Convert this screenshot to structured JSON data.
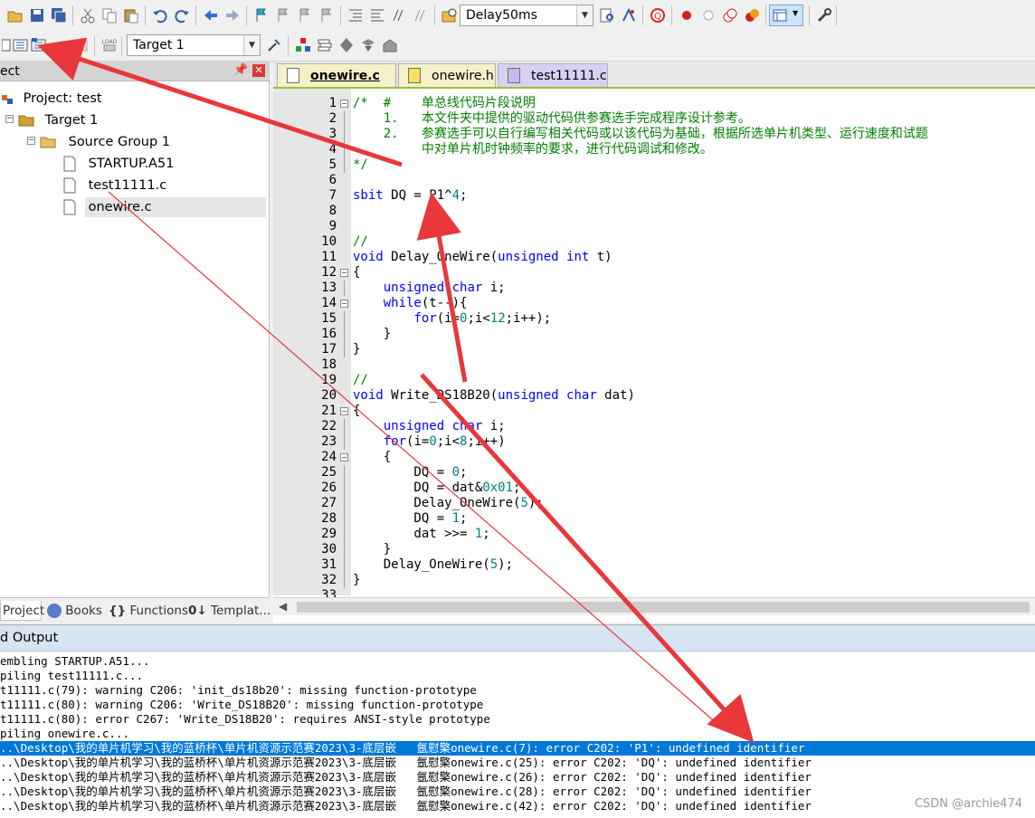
{
  "toolbar1": {
    "function_combo": "Delay50ms"
  },
  "toolbar2": {
    "target_combo": "Target 1"
  },
  "project_panel": {
    "title": "ect",
    "tree": [
      {
        "label": "Project: test",
        "icon": "project-icon"
      },
      {
        "label": "Target 1",
        "icon": "folder-icon"
      },
      {
        "label": "Source Group 1",
        "icon": "folder-icon"
      },
      {
        "label": "STARTUP.A51",
        "icon": "file-icon"
      },
      {
        "label": "test11111.c",
        "icon": "file-icon"
      },
      {
        "label": "onewire.c",
        "icon": "file-icon"
      }
    ],
    "tabs": [
      {
        "label": "Project"
      },
      {
        "label": "Books"
      },
      {
        "label": "Functions"
      },
      {
        "label": "Templat..."
      }
    ]
  },
  "editor": {
    "tabs": [
      {
        "label": "onewire.c",
        "color": "#f5f0c8",
        "active": true
      },
      {
        "label": "onewire.h",
        "color": "#f5f0c8",
        "active": false
      },
      {
        "label": "test11111.c",
        "color": "#d8d0f0",
        "active": false
      }
    ],
    "line_numbers": [
      "1",
      "2",
      "3",
      "4",
      "5",
      "6",
      "7",
      "8",
      "9",
      "10",
      "11",
      "12",
      "13",
      "14",
      "15",
      "16",
      "17",
      "18",
      "19",
      "20",
      "21",
      "22",
      "23",
      "24",
      "25",
      "26",
      "27",
      "28",
      "29",
      "30",
      "31",
      "32",
      "33"
    ],
    "lines": [
      "/*  #    单总线代码片段说明",
      "    1.   本文件夹中提供的驱动代码供参赛选手完成程序设计参考。",
      "    2.   参赛选手可以自行编写相关代码或以该代码为基础，根据所选单片机类型、运行速度和试题",
      "         中对单片机时钟频率的要求，进行代码调试和修改。",
      "*/",
      "",
      "sbit DQ = P1^4;",
      "",
      "",
      "//",
      "void Delay_OneWire(unsigned int t)",
      "{",
      "    unsigned char i;",
      "    while(t--){",
      "        for(i=0;i<12;i++);",
      "    }",
      "}",
      "",
      "//",
      "void Write_DS18B20(unsigned char dat)",
      "{",
      "    unsigned char i;",
      "    for(i=0;i<8;i++)",
      "    {",
      "        DQ = 0;",
      "        DQ = dat&0x01;",
      "        Delay_OneWire(5);",
      "        DQ = 1;",
      "        dat >>= 1;",
      "    }",
      "    Delay_OneWire(5);",
      "}",
      ""
    ]
  },
  "output": {
    "title": "d Output",
    "lines": [
      "embling STARTUP.A51...",
      "piling test11111.c...",
      "t11111.c(79): warning C206: 'init_ds18b20': missing function-prototype",
      "t11111.c(80): warning C206: 'Write_DS18B20': missing function-prototype",
      "t11111.c(80): error C267: 'Write_DS18B20': requires ANSI-style prototype",
      "piling onewire.c...",
      "..\\Desktop\\我的单片机学习\\我的蓝桥杯\\单片机资源示范赛2023\\3-底层嵌   氬慰檠onewire.c(7): error C202: 'P1': undefined identifier",
      "..\\Desktop\\我的单片机学习\\我的蓝桥杯\\单片机资源示范赛2023\\3-底层嵌   氬慰檠onewire.c(25): error C202: 'DQ': undefined identifier",
      "..\\Desktop\\我的单片机学习\\我的蓝桥杯\\单片机资源示范赛2023\\3-底层嵌   氬慰檠onewire.c(26): error C202: 'DQ': undefined identifier",
      "..\\Desktop\\我的单片机学习\\我的蓝桥杯\\单片机资源示范赛2023\\3-底层嵌   氬慰檠onewire.c(28): error C202: 'DQ': undefined identifier",
      "..\\Desktop\\我的单片机学习\\我的蓝桥杯\\单片机资源示范赛2023\\3-底层嵌   氬慰檠onewire.c(42): error C202: 'DQ': undefined identifier"
    ],
    "selected_line": 6
  },
  "watermark": "CSDN @archie474",
  "arrow_color": "#e8383b"
}
